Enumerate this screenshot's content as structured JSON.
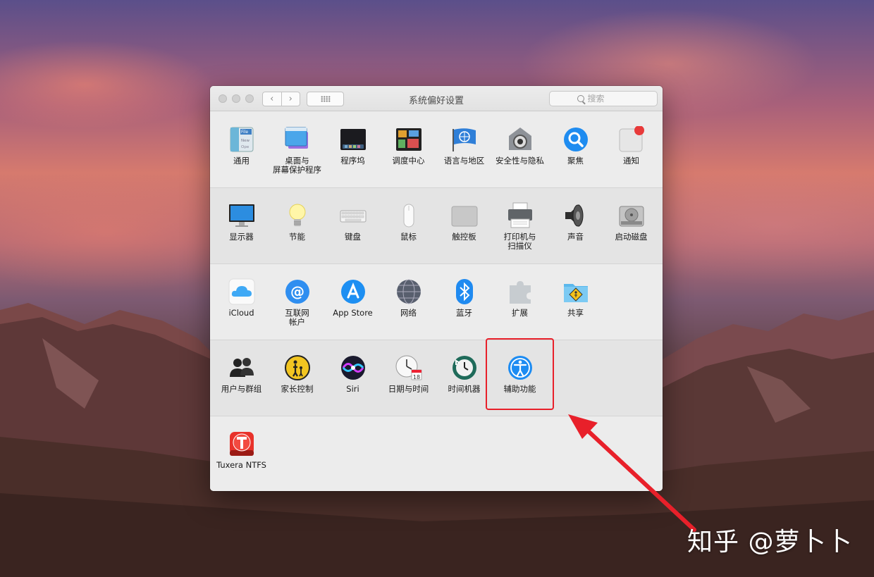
{
  "window": {
    "title": "系统偏好设置",
    "search_placeholder": "搜索",
    "back_glyph": "‹",
    "forward_glyph": "›"
  },
  "rows": [
    [
      {
        "label": "通用",
        "icon": "general-icon"
      },
      {
        "label": "桌面与\n屏幕保护程序",
        "icon": "desktop-screensaver-icon"
      },
      {
        "label": "程序坞",
        "icon": "dock-icon"
      },
      {
        "label": "调度中心",
        "icon": "mission-control-icon"
      },
      {
        "label": "语言与地区",
        "icon": "language-region-icon"
      },
      {
        "label": "安全性与隐私",
        "icon": "security-privacy-icon"
      },
      {
        "label": "聚焦",
        "icon": "spotlight-icon"
      },
      {
        "label": "通知",
        "icon": "notifications-icon"
      }
    ],
    [
      {
        "label": "显示器",
        "icon": "displays-icon"
      },
      {
        "label": "节能",
        "icon": "energy-saver-icon"
      },
      {
        "label": "键盘",
        "icon": "keyboard-icon"
      },
      {
        "label": "鼠标",
        "icon": "mouse-icon"
      },
      {
        "label": "触控板",
        "icon": "trackpad-icon"
      },
      {
        "label": "打印机与\n扫描仪",
        "icon": "printers-scanners-icon"
      },
      {
        "label": "声音",
        "icon": "sound-icon"
      },
      {
        "label": "启动磁盘",
        "icon": "startup-disk-icon"
      }
    ],
    [
      {
        "label": "iCloud",
        "icon": "icloud-icon"
      },
      {
        "label": "互联网\n帐户",
        "icon": "internet-accounts-icon"
      },
      {
        "label": "App Store",
        "icon": "app-store-icon"
      },
      {
        "label": "网络",
        "icon": "network-icon"
      },
      {
        "label": "蓝牙",
        "icon": "bluetooth-icon"
      },
      {
        "label": "扩展",
        "icon": "extensions-icon"
      },
      {
        "label": "共享",
        "icon": "sharing-icon"
      }
    ],
    [
      {
        "label": "用户与群组",
        "icon": "users-groups-icon"
      },
      {
        "label": "家长控制",
        "icon": "parental-controls-icon"
      },
      {
        "label": "Siri",
        "icon": "siri-icon"
      },
      {
        "label": "日期与时间",
        "icon": "date-time-icon"
      },
      {
        "label": "时间机器",
        "icon": "time-machine-icon"
      },
      {
        "label": "辅助功能",
        "icon": "accessibility-icon"
      }
    ],
    [
      {
        "label": "Tuxera NTFS",
        "icon": "tuxera-ntfs-icon"
      }
    ]
  ],
  "date_icon_day": "18",
  "watermark": "知乎 @萝卜卜",
  "colors": {
    "highlight": "#e8202a",
    "arrow": "#e8202a"
  }
}
